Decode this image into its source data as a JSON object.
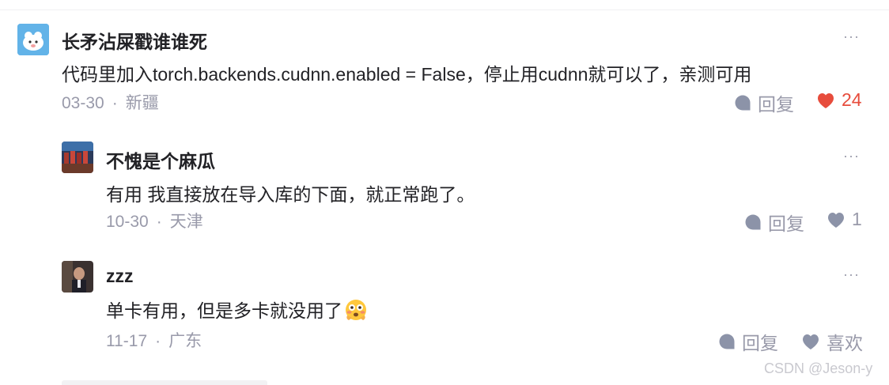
{
  "comments": [
    {
      "username": "长矛沾屎戳谁谁死",
      "text": "代码里加入torch.backends.cudnn.enabled = False，停止用cudnn就可以了，亲测可用",
      "date": "03-30",
      "location": "新疆",
      "reply_label": "回复",
      "like_label": "24",
      "liked": true
    },
    {
      "username": "不愧是个麻瓜",
      "text": "有用 我直接放在导入库的下面，就正常跑了。",
      "date": "10-30",
      "location": "天津",
      "reply_label": "回复",
      "like_label": "1",
      "liked": false
    },
    {
      "username": "zzz",
      "text": "单卡有用，但是多卡就没用了",
      "emoji": "flushed-face-icon",
      "date": "11-17",
      "location": "广东",
      "reply_label": "回复",
      "like_label": "喜欢",
      "liked": false
    }
  ],
  "more_label": "···",
  "separator": "·",
  "watermark": "CSDN @Jeson-y",
  "colors": {
    "liked": "#e74c3c",
    "muted": "#999aaa",
    "icon": "#8c93a8"
  }
}
